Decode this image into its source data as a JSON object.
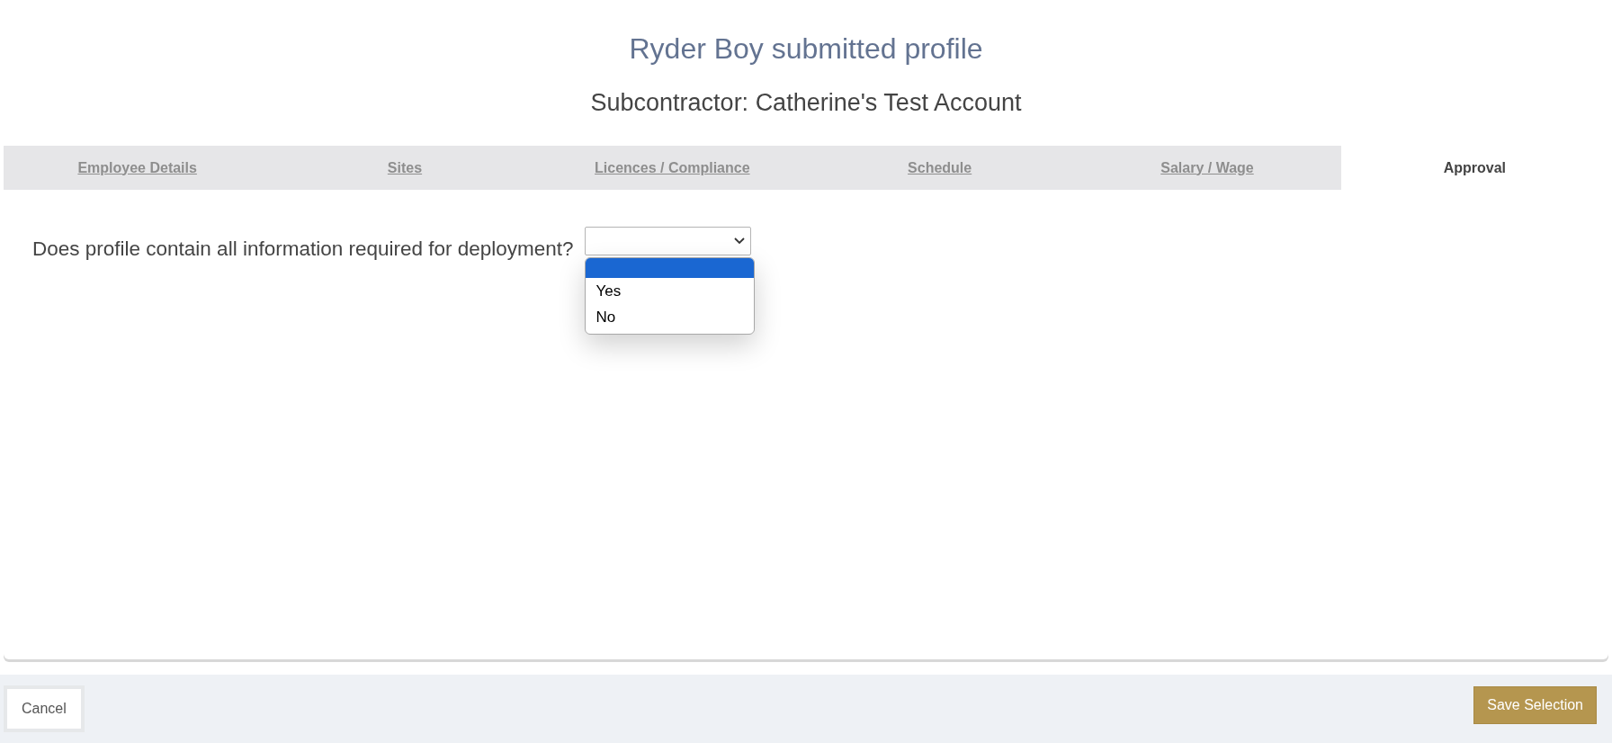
{
  "title": "Ryder Boy submitted profile",
  "subtitle": "Subcontractor: Catherine's Test Account",
  "tabs": [
    {
      "label": "Employee Details",
      "selected": false
    },
    {
      "label": "Sites",
      "selected": false
    },
    {
      "label": "Licences / Compliance",
      "selected": false
    },
    {
      "label": "Schedule",
      "selected": false
    },
    {
      "label": "Salary / Wage",
      "selected": false
    },
    {
      "label": "Approval",
      "selected": true
    }
  ],
  "question": {
    "label": "Does profile contain all information required for deployment?",
    "expanded": true,
    "blank_option": {
      "selected": true
    },
    "options": [
      {
        "label": "Yes",
        "selected": false
      },
      {
        "label": "No",
        "selected": false
      }
    ]
  },
  "footer": {
    "cancel": "Cancel",
    "save": "Save Selection"
  }
}
